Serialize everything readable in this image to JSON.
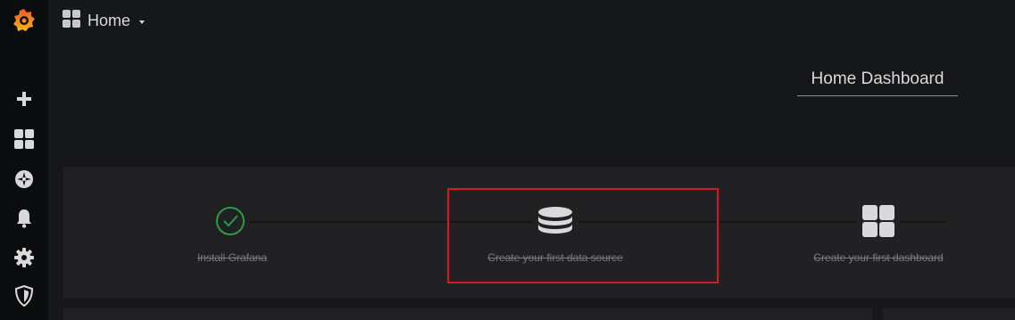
{
  "sidebar": {
    "items": [
      {
        "icon": "grafana-logo-icon"
      },
      {
        "icon": "plus-icon"
      },
      {
        "icon": "dashboards-icon"
      },
      {
        "icon": "explore-compass-icon"
      },
      {
        "icon": "alerting-bell-icon"
      },
      {
        "icon": "configuration-gear-icon"
      },
      {
        "icon": "server-admin-shield-icon"
      }
    ]
  },
  "topnav": {
    "home_label": "Home"
  },
  "dashboard": {
    "title": "Home Dashboard"
  },
  "getting_started": {
    "steps": [
      {
        "label": "Install Grafana",
        "icon": "check-circle-icon",
        "done": true
      },
      {
        "label": "Create your first data source",
        "icon": "database-icon",
        "done": true
      },
      {
        "label": "Create your first dashboard",
        "icon": "dashboards-icon",
        "done": true
      }
    ]
  },
  "colors": {
    "accent": "#eb7b18",
    "success": "#299c46",
    "highlight": "#d11b1f"
  }
}
